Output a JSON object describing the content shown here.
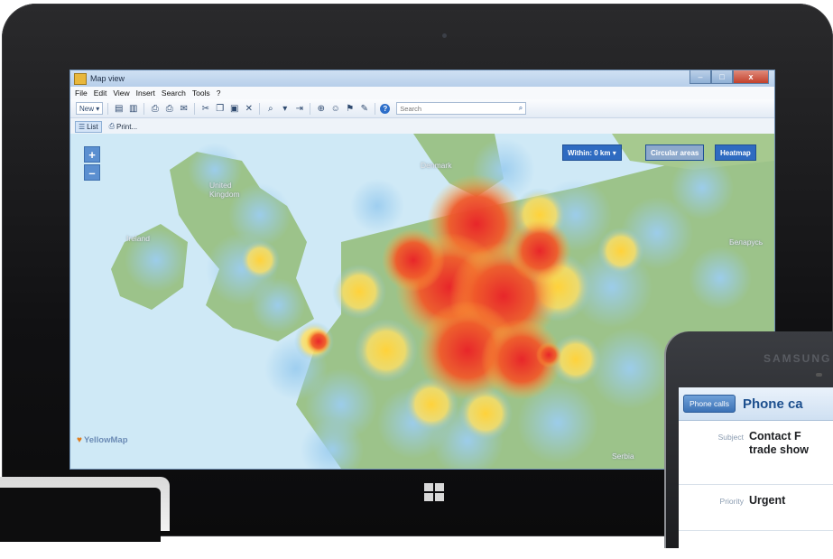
{
  "window": {
    "title": "Map view",
    "controls": {
      "minimize": "–",
      "maximize": "□",
      "close": "x"
    }
  },
  "menu": [
    "File",
    "Edit",
    "View",
    "Insert",
    "Search",
    "Tools",
    "?"
  ],
  "toolbar": {
    "new_label": "New",
    "search_placeholder": "Search",
    "icons": [
      "new-icon",
      "cut-icon",
      "copy-icon",
      "paste-icon",
      "delete-icon",
      "find-icon",
      "export-icon",
      "help-icon"
    ]
  },
  "subtoolbar": {
    "list_label": "List",
    "print_label": "Print..."
  },
  "map": {
    "zoom_in": "+",
    "zoom_out": "–",
    "within_label": "Within: 0 km",
    "circular_areas_label": "Circular areas",
    "heatmap_label": "Heatmap",
    "logo_text": "YellowMap",
    "labels": [
      "United Kingdom",
      "Ireland",
      "Denmark",
      "Беларусь",
      "Serbia"
    ]
  },
  "phone": {
    "brand": "SAMSUNG",
    "back_label": "Phone calls",
    "title": "Phone ca",
    "rows": [
      {
        "label": "Subject",
        "value": "Contact F trade show"
      },
      {
        "label": "Priority",
        "value": "Urgent"
      }
    ]
  },
  "colors": {
    "accent": "#2f6bc1",
    "sea": "#cfe9f6",
    "land": "#8fb878",
    "heat_cold": "#7fb8e6",
    "heat_warm": "#ffd84a",
    "heat_hot": "#e8312a"
  }
}
